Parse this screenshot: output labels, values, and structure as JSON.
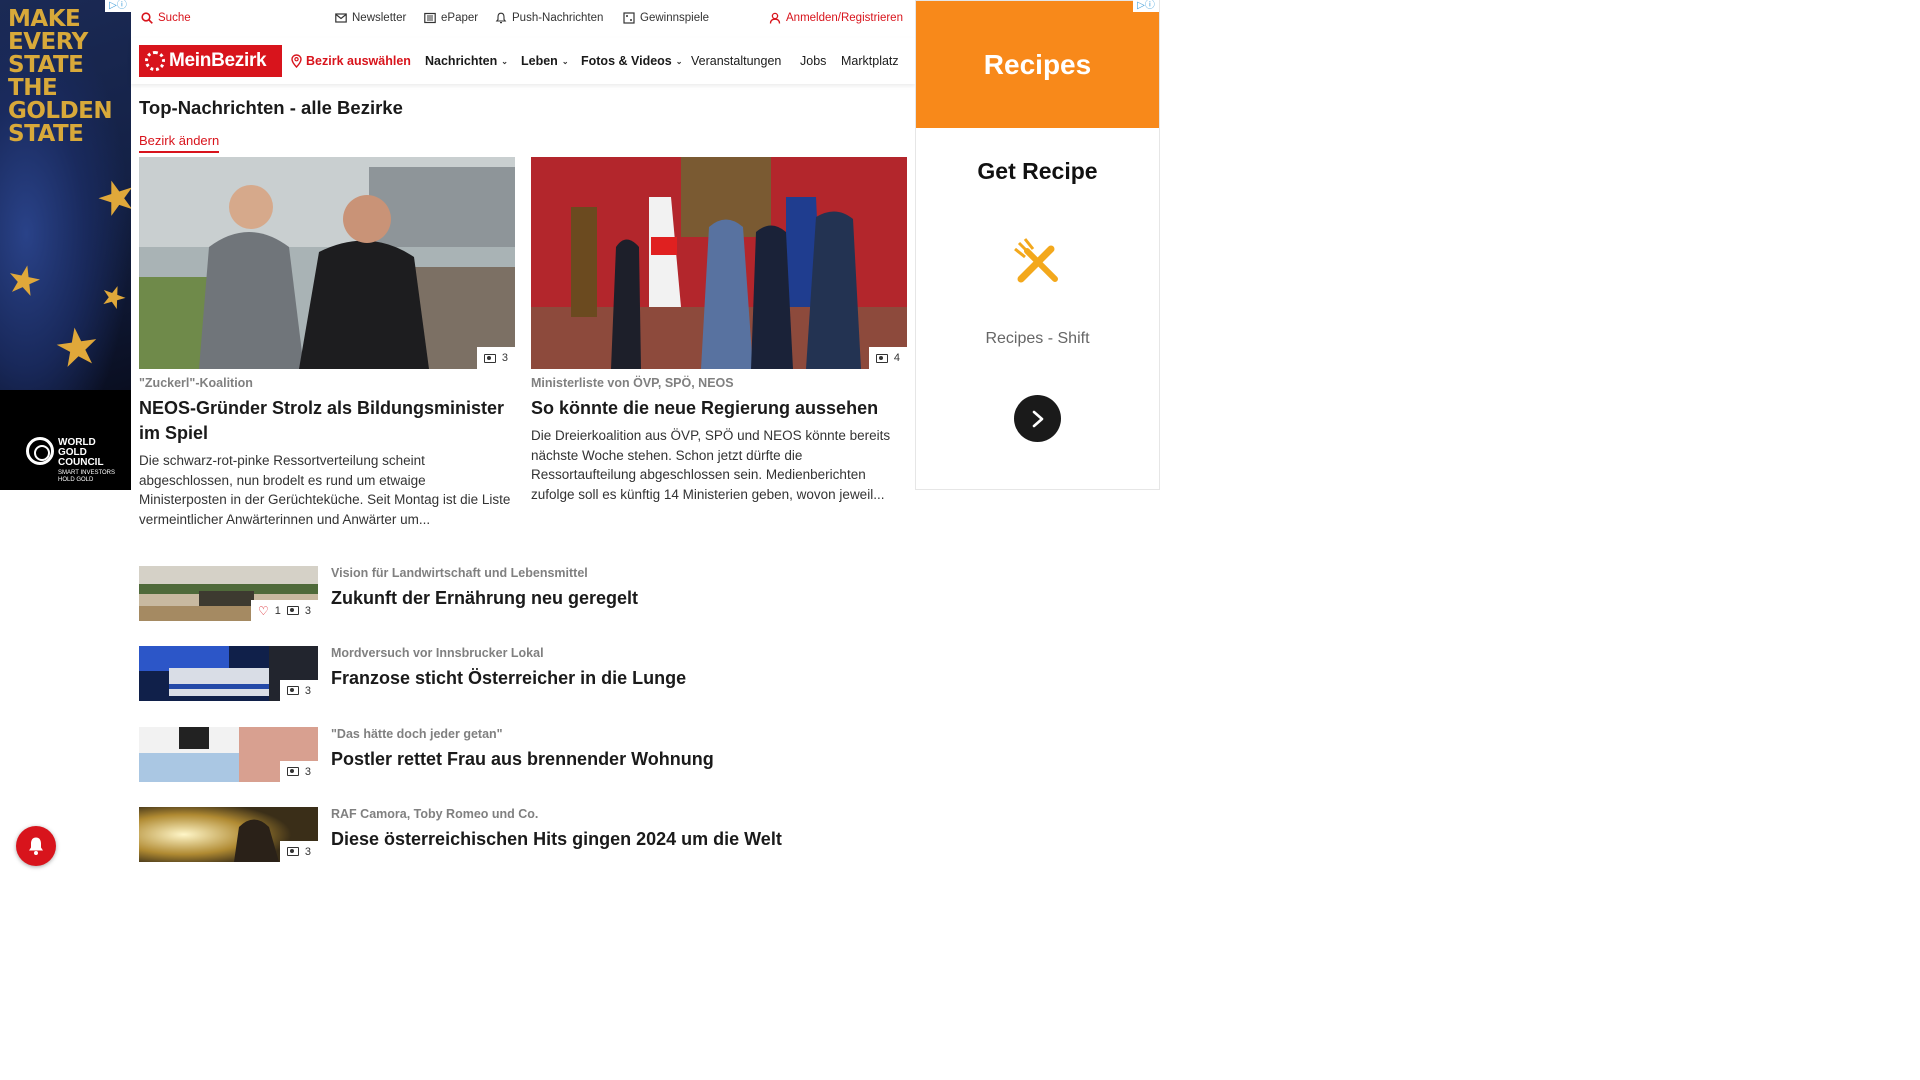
{
  "ads": {
    "left": {
      "headline": "MAKE\nEVERY\nSTATE\nTHE\nGOLDEN\nSTATE",
      "brand": "WORLD\nGOLD\nCOUNCIL",
      "tagline": "SMART INVESTORS\nHOLD GOLD"
    },
    "right": {
      "header": "Recipes",
      "title": "Get Recipe",
      "subtitle": "Recipes - Shift"
    },
    "choice_icon": "adchoices-icon"
  },
  "topbar": {
    "search": "Suche",
    "newsletter": "Newsletter",
    "epaper": "ePaper",
    "push": "Push-Nachrichten",
    "gewinnspiele": "Gewinnspiele",
    "login": "Anmelden/Registrieren"
  },
  "nav": {
    "logo": "MeinBezirk",
    "pick_district": "Bezirk auswählen",
    "items": [
      {
        "label": "Nachrichten",
        "has_dropdown": true
      },
      {
        "label": "Leben",
        "has_dropdown": true
      },
      {
        "label": "Fotos & Videos",
        "has_dropdown": true
      },
      {
        "label": "Veranstaltungen",
        "has_dropdown": false
      },
      {
        "label": "Jobs",
        "has_dropdown": false
      },
      {
        "label": "Marktplatz",
        "has_dropdown": false
      }
    ]
  },
  "section": {
    "title": "Top-Nachrichten - alle Bezirke",
    "change_district": "Bezirk ändern"
  },
  "featured": [
    {
      "kicker": "\"Zuckerl\"-Koalition",
      "headline": "NEOS-Gründer Strolz als Bildungsminister im Spiel",
      "lead": "Die schwarz-rot-pinke Ressortverteilung scheint abgeschlossen, nun brodelt es rund um etwaige Ministerposten in der Gerüchteküche. Seit Montag ist die Liste vermeintlicher Anwärterinnen und Anwärter um...",
      "photo_count": "3"
    },
    {
      "kicker": "Ministerliste von ÖVP, SPÖ, NEOS",
      "headline": "So könnte die neue Regierung aussehen",
      "lead": "Die Dreierkoalition aus ÖVP, SPÖ und NEOS könnte bereits nächste Woche stehen. Schon jetzt dürfte die Ressortaufteilung abgeschlossen sein. Medienberichten zufolge soll es künftig 14 Ministerien geben, wovon jeweil...",
      "photo_count": "4"
    }
  ],
  "list": [
    {
      "kicker": "Vision für Landwirtschaft und Lebensmittel",
      "headline": "Zukunft der Ernährung neu geregelt",
      "likes": "1",
      "photo_count": "3"
    },
    {
      "kicker": "Mordversuch vor Innsbrucker Lokal",
      "headline": "Franzose sticht Österreicher in die Lunge",
      "photo_count": "3"
    },
    {
      "kicker": "\"Das hätte doch jeder getan\"",
      "headline": "Postler rettet Frau aus brennender Wohnung",
      "photo_count": "3"
    },
    {
      "kicker": "RAF Camora, Toby Romeo und Co.",
      "headline": "Diese österreichischen Hits gingen 2024 um die Welt",
      "photo_count": "3"
    }
  ],
  "colors": {
    "brand_red": "#d8141c",
    "ad_orange": "#f8891a",
    "kicker_gray": "#808080"
  }
}
